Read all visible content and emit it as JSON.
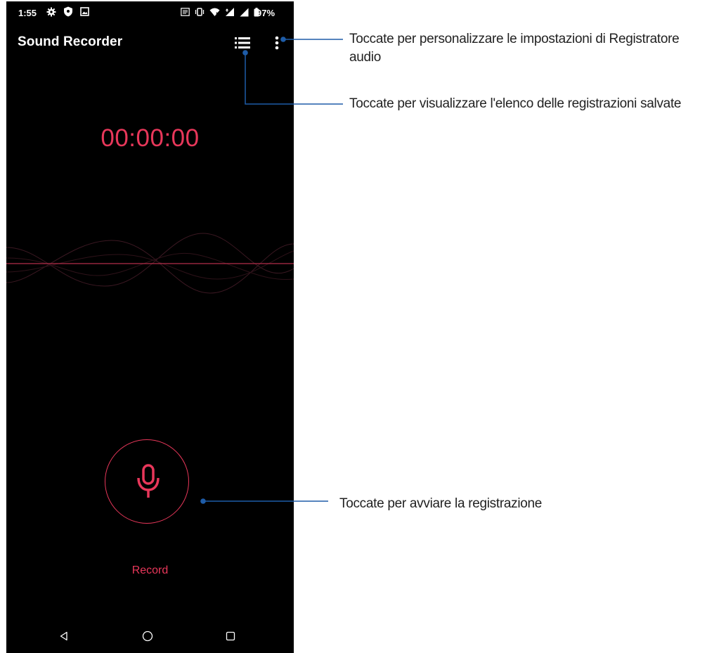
{
  "status_bar": {
    "time": "1:55",
    "battery": "97%",
    "left_icons": [
      "gear-icon",
      "shield-icon",
      "image-icon"
    ],
    "right_icons": [
      "nfc-icon",
      "vibrate-icon",
      "wifi-icon",
      "data-icon",
      "signal-icon",
      "battery-icon"
    ]
  },
  "app": {
    "title": "Sound Recorder",
    "timer": "00:00:00",
    "record_label": "Record",
    "accent_color": "#e8375a",
    "background_color": "#000000"
  },
  "toolbar": {
    "list_icon": "list-icon",
    "more_icon": "more-vert-icon"
  },
  "nav_bar": {
    "icons": [
      "back-icon",
      "home-icon",
      "recents-icon"
    ]
  },
  "annotations": {
    "line_color": "#1e5ca8",
    "settings": "Toccate per personalizzare le impostazioni di Registratore audio",
    "recordings_list": "Toccate per visualizzare l'elenco delle registrazioni salvate",
    "start_recording": "Toccate per avviare la registrazione"
  }
}
